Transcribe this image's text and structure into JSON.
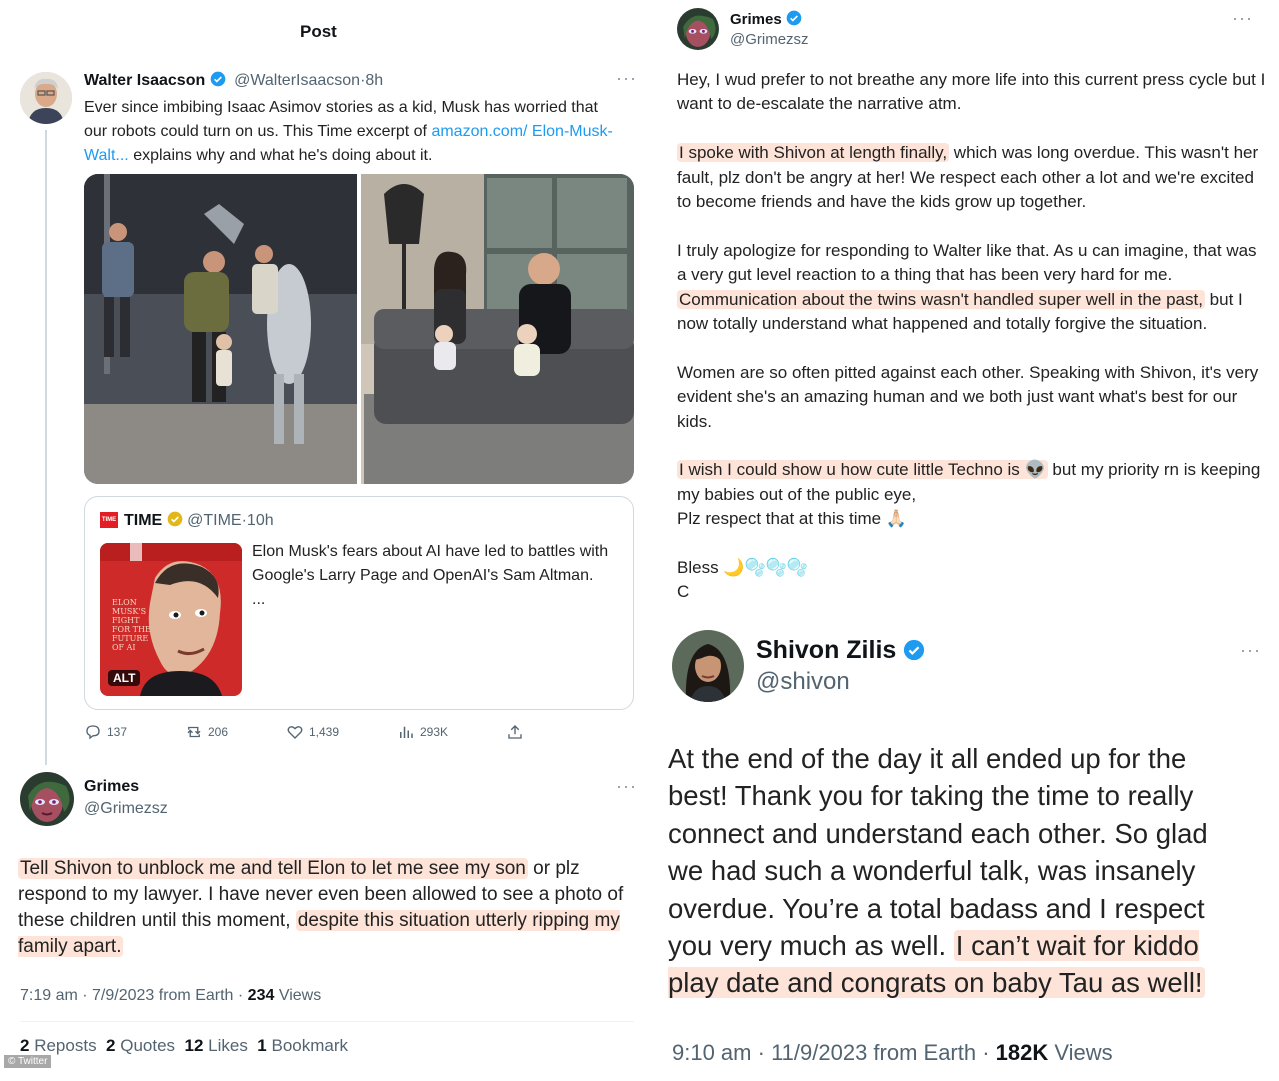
{
  "colors": {
    "highlight": "#fde3d8",
    "link": "#1d9bf0",
    "verified": "#1d9bf0",
    "muted": "#536471"
  },
  "left_post": {
    "header_title": "Post",
    "tweet": {
      "author_name": "Walter Isaacson",
      "author_handle": "@WalterIsaacson",
      "time": "8h",
      "text_before_link": "Ever since imbibing Isaac Asimov stories as a kid, Musk has worried that our robots could turn on us.  This Time excerpt of ",
      "link_text": "amazon.com/ Elon-Musk-Walt...",
      "text_after_link": " explains why and what he's doing about it.",
      "quote": {
        "author_name": "TIME",
        "author_handle": "@TIME",
        "time": "10h",
        "logo_text": "TIME",
        "alt_badge": "ALT",
        "text": "Elon Musk's fears about AI have led to battles with Google's Larry Page and OpenAI's Sam Altman.",
        "ellipsis": "..."
      },
      "actions": {
        "replies": "137",
        "reposts": "206",
        "likes": "1,439",
        "views": "293K"
      }
    },
    "reply": {
      "author_name": "Grimes",
      "author_handle": "@Grimezsz",
      "text_hl1": "Tell Shivon to unblock me and tell Elon to let me see my son",
      "text_mid": " or plz respond to my lawyer.  I have never even been allowed to see a photo of these children until this moment, ",
      "text_hl2": "despite this situation utterly ripping my family apart.",
      "time": "7:19 am",
      "date": "7/9/2023 from Earth",
      "views_count": "234",
      "views_label": "Views",
      "reposts_count": "2",
      "reposts_label": "Reposts",
      "quotes_count": "2",
      "quotes_label": "Quotes",
      "likes_count": "12",
      "likes_label": "Likes",
      "bookmarks_count": "1",
      "bookmarks_label": "Bookmark",
      "watermark": "© Twitter"
    }
  },
  "right_grimes": {
    "author_name": "Grimes",
    "author_handle": "@Grimezsz",
    "p1": "Hey, I wud prefer to not breathe any more life into this current press cycle but I want to de-escalate the narrative atm.",
    "p2_hl": "I spoke with Shivon at length finally,",
    "p2_rest": " which was long overdue.  This wasn't her fault, plz don't be angry at her!  We respect each other a lot and we're excited to become friends and have the kids grow up together.",
    "p3_start": "I truly apologize for responding to Walter like that.  As u can imagine, that was a very gut level reaction to a thing that has been very hard for me. ",
    "p3_hl": "Communication about the twins wasn't handled super well in the past,",
    "p3_rest": " but I now totally understand what happened and totally forgive the situation.",
    "p4": "Women are so often pitted against each other.  Speaking with Shivon, it's very evident  she's an amazing human and we both just want what's best for our kids.",
    "p5_hl": "I wish I could show u how cute little Techno is 👽",
    "p5_rest": " but my priority rn is keeping my babies out of the public eye,",
    "p5_line2": "Plz respect that at this time 🙏🏻",
    "bless": "Bless 🌙🫧🫧🫧",
    "sign": "C"
  },
  "right_shivon": {
    "author_name": "Shivon Zilis",
    "author_handle": "@shivon",
    "text_main": "At the end of the day it all ended up for the best! Thank you for taking the time to really connect and understand each other. So glad we had such a wonderful talk, was insanely overdue. You’re a total badass and I respect you very much as well. ",
    "text_hl": "I can’t wait for kiddo play date and congrats on baby Tau as well!",
    "time": "9:10 am",
    "date": "11/9/2023 from Earth",
    "views_count": "182K",
    "views_label": "Views"
  }
}
